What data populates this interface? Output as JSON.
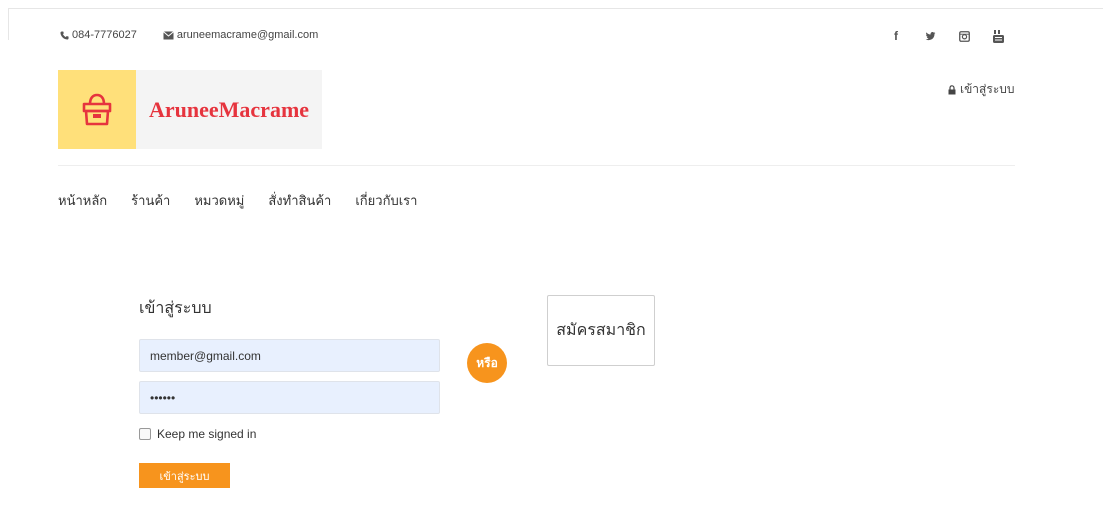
{
  "topbar": {
    "phone": "084-7776027",
    "email": "aruneemacrame@gmail.com",
    "social": [
      "facebook-icon",
      "twitter-icon",
      "instagram-icon",
      "youtube-icon"
    ],
    "social_glyphs": [
      "f",
      "🐦",
      "◙",
      "▶"
    ]
  },
  "brand": {
    "name": "AruneeMacrame",
    "accent": "#e6343e",
    "mark_bg": "#ffe07a"
  },
  "header": {
    "login_label": "เข้าสู่ระบบ"
  },
  "nav": {
    "items": [
      "หน้าหลัก",
      "ร้านค้า",
      "หมวดหมู่",
      "สั่งทำสินค้า",
      "เกี่ยวกับเรา"
    ]
  },
  "login_form": {
    "title": "เข้าสู่ระบบ",
    "email_value": "member@gmail.com",
    "password_value": "••••••",
    "remember_label": "Keep me signed in",
    "remember_checked": false,
    "submit_label": "เข้าสู่ระบบ"
  },
  "divider_label": "หรือ",
  "register": {
    "label": "สมัครสมาชิก"
  },
  "colors": {
    "primary_orange": "#f7941d",
    "input_bg": "#e8f0fe"
  }
}
